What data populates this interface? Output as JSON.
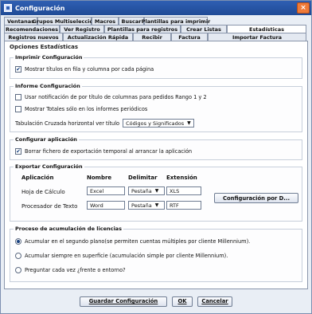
{
  "window": {
    "title": "Configuración",
    "close_label": "×"
  },
  "tabs": {
    "row1": [
      "Ventanas",
      "Grupos Multiselección",
      "Macros",
      "Buscar",
      "Plantillas para imprimir"
    ],
    "row2": [
      "Recomendaciones",
      "Ver Registro",
      "Plantillas para registros",
      "Crear Listas",
      "Estadísticas"
    ],
    "row3": [
      "Registros nuevos",
      "Actualización Rápida",
      "Recibir",
      "Factura",
      "Importar Factura"
    ],
    "active": "Estadísticas"
  },
  "panel": {
    "heading": "Opciones Estadísticas",
    "print": {
      "title": "Imprimir Configuración",
      "option1": "Mostrar títulos en fila y columna por cada página",
      "option1_checked": "✔"
    },
    "report": {
      "title": "Informe Configuración",
      "option1": "Usar notificación de por título de columnas para pedidos Rango 1 y 2",
      "option2": "Mostrar Totales sólo en los informes periódicos",
      "tabulation_label": "Tabulación Cruzada horizontal ver título",
      "tabulation_value": "Códigos y Significados"
    },
    "app": {
      "title": "Configurar aplicación",
      "option1": "Borrar fichero de exportación temporal al arrancar la aplicación",
      "option1_checked": "✔"
    },
    "export": {
      "title": "Exportar Configuración",
      "col_app": "Aplicación",
      "col_name": "Nombre",
      "col_delim": "Delimitar",
      "col_ext": "Extensión",
      "row1_app": "Hoja de Cálculo",
      "row1_name": "Excel",
      "row1_delim": "Pestaña",
      "row1_ext": "XLS",
      "row2_app": "Procesador de Texto",
      "row2_name": "Word",
      "row2_delim": "Pestaña",
      "row2_ext": "RTF",
      "config_button": "Configuración por D..."
    },
    "license": {
      "title": "Proceso de acumulación de licencias",
      "option1": "Acumular en el segundo plano(se permiten cuentas múltiples por cliente Millennium).",
      "option2": "Acumular siempre en superficie (acumulación simple por cliente Millennium).",
      "option3": "Preguntar cada vez ¿frente o entorno?"
    }
  },
  "footer": {
    "save": "Guardar Configuración",
    "ok": "OK",
    "cancel": "Cancelar"
  }
}
